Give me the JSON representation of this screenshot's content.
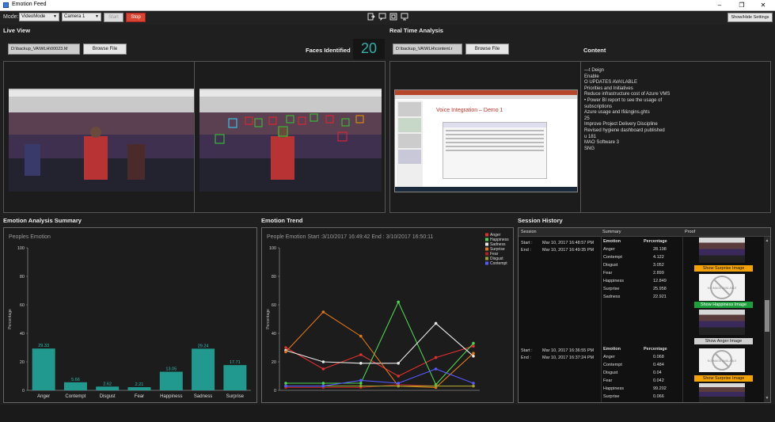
{
  "window": {
    "title": "Emotion Feed",
    "minimize": "–",
    "restore": "❐",
    "close": "✕"
  },
  "toolbar": {
    "mode_label": "Mode:",
    "mode_value": "VideoMode",
    "camera_value": "Camera 1",
    "start_label": "Start",
    "stop_label": "Stop",
    "settings_label": "Show/Hide Settings"
  },
  "live_view": {
    "title": "Live View",
    "file_path": "D:\\backup_VA\\WLH\\00023.M",
    "browse_label": "Browse File",
    "faces_label": "Faces Identified",
    "faces_count": "20"
  },
  "realtime": {
    "title": "Real Time Analysis",
    "file_path": "D:\\backup_VA\\WLH\\content.r",
    "browse_label": "Browse File",
    "content_label": "Content",
    "slide_title": "Voice Integration – Demo 1",
    "content_lines": [
      "—t Deign",
      "Enable",
      "O UPDATES AVA!LABLE",
      "Priorities and Initiatives",
      "Reduce infrastructure cost of Azure VMS",
      "• Power BI report to see the usage of",
      "subscriptions",
      "Azure usage and lfi&ngins.ghts",
      "25",
      "Improve Project Delivery Discipline",
      "Revised hygiene dashboard published",
      "u 181",
      "MAO Software 3",
      "SNG"
    ]
  },
  "summary": {
    "title": "Emotion Analysis Summary",
    "chart_data": {
      "type": "bar",
      "title": "Peoples Emotion",
      "ylabel": "Percentage",
      "ylim": [
        0,
        100
      ],
      "yticks": [
        0,
        20,
        40,
        60,
        80,
        100
      ],
      "categories": [
        "Anger",
        "Contempt",
        "Disgust",
        "Fear",
        "Happiness",
        "Sadness",
        "Surprise"
      ],
      "values": [
        29.33,
        5.66,
        2.62,
        2.21,
        13.05,
        29.24,
        17.71
      ],
      "labels": [
        "29.33",
        "5.66",
        "2.62",
        "2.21",
        "13.05",
        "29.24",
        "17.71"
      ],
      "color": "#21998f"
    }
  },
  "trend": {
    "title": "Emotion Trend",
    "chart_data": {
      "type": "line",
      "title": "People Emotion Start :3/10/2017 16:49:42 End : 3/10/2017 16:50:11",
      "ylabel": "Percentage",
      "ylim": [
        0,
        100
      ],
      "yticks": [
        0,
        20,
        40,
        60,
        80,
        100
      ],
      "x": [
        1,
        2,
        3,
        4,
        5,
        6
      ],
      "series": [
        {
          "name": "Anger",
          "color": "#e03030",
          "values": [
            30,
            15,
            25,
            10,
            23,
            31
          ]
        },
        {
          "name": "Happiness",
          "color": "#4ed44e",
          "values": [
            5,
            5,
            5,
            62,
            4,
            33
          ]
        },
        {
          "name": "Sadness",
          "color": "#e8e8e8",
          "values": [
            28,
            20,
            19,
            19,
            47,
            24
          ]
        },
        {
          "name": "Surprise",
          "color": "#e07818",
          "values": [
            27,
            55,
            38,
            3,
            2,
            26
          ]
        },
        {
          "name": "Fear",
          "color": "#b02020",
          "values": [
            2,
            2,
            2,
            4,
            3,
            3
          ]
        },
        {
          "name": "Disgust",
          "color": "#9aa030",
          "values": [
            3,
            3,
            3,
            3,
            3,
            3
          ]
        },
        {
          "name": "Contempt",
          "color": "#5858ff",
          "values": [
            3,
            3,
            7,
            5,
            15,
            5
          ]
        }
      ]
    }
  },
  "history": {
    "title": "Session History",
    "headers": {
      "session": "Session",
      "summary": "Summary",
      "proof": "Proof"
    },
    "start_label": "Start :",
    "end_label": "End :",
    "emotion_header": "Emotion",
    "percentage_header": "Percentage",
    "sessions": [
      {
        "start": "Mar 10, 2017 16:48:57 PM",
        "end": "Mar 10, 2017 16:49:35 PM",
        "rows": [
          {
            "emotion": "Anger",
            "pct": "28.198"
          },
          {
            "emotion": "Contempt",
            "pct": "4.122"
          },
          {
            "emotion": "Disgust",
            "pct": "3.052"
          },
          {
            "emotion": "Fear",
            "pct": "2.899"
          },
          {
            "emotion": "Happiness",
            "pct": "12.849"
          },
          {
            "emotion": "Surprise",
            "pct": "25.958"
          },
          {
            "emotion": "Sadness",
            "pct": "22.921"
          }
        ]
      },
      {
        "start": "Mar 10, 2017 16:36:55 PM",
        "end": "Mar 10, 2017 16:37:24 PM",
        "rows": [
          {
            "emotion": "Anger",
            "pct": "0.068"
          },
          {
            "emotion": "Contempt",
            "pct": "0.484"
          },
          {
            "emotion": "Disgust",
            "pct": "0.04"
          },
          {
            "emotion": "Fear",
            "pct": "0.042"
          },
          {
            "emotion": "Happiness",
            "pct": "99.202"
          },
          {
            "emotion": "Surprise",
            "pct": "0.066"
          }
        ]
      }
    ],
    "proof_buttons": [
      {
        "label": "Show Surprise Image",
        "color": "#f5a300"
      },
      {
        "label": "Show Happiness Image",
        "color": "#1e9e3c"
      },
      {
        "label": "Show Anger Image",
        "color": "#d0d0d0"
      },
      {
        "label": "Show Surprise Image",
        "color": "#f5a300"
      }
    ],
    "no_image_text": "NO IMAGE AVAILABLE"
  }
}
